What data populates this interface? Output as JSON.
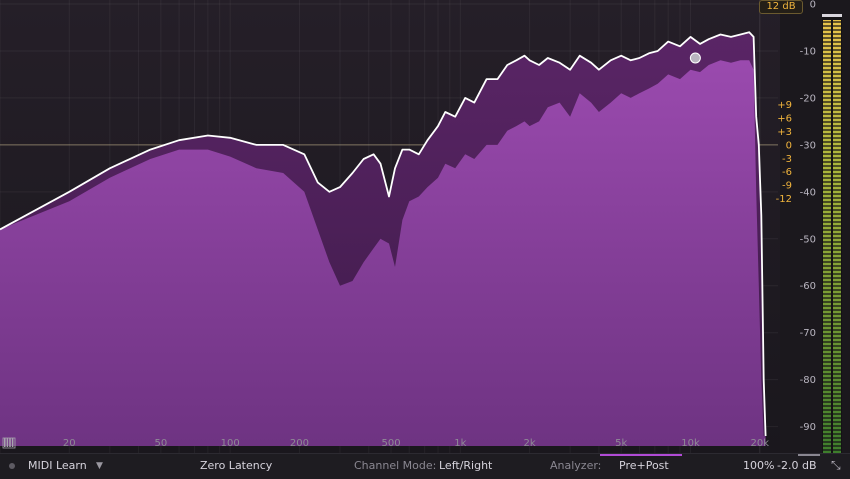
{
  "display": {
    "range_badge": "12 dB",
    "freq_labels": [
      "20",
      "50",
      "100",
      "200",
      "500",
      "1k",
      "2k",
      "5k",
      "10k",
      "20k"
    ],
    "freq_values": [
      20,
      50,
      100,
      200,
      500,
      1000,
      2000,
      5000,
      10000,
      20000
    ],
    "gain_labels": [
      "+9",
      "+6",
      "+3",
      "0",
      "-3",
      "-6",
      "-9",
      "-12"
    ],
    "gain_values": [
      9,
      6,
      3,
      0,
      -3,
      -6,
      -9,
      -12
    ],
    "analyzer_labels": [
      "0",
      "-10",
      "-20",
      "-30",
      "-40",
      "-50",
      "-60",
      "-70",
      "-80",
      "-90"
    ],
    "analyzer_values": [
      0,
      -10,
      -20,
      -30,
      -40,
      -50,
      -60,
      -70,
      -80,
      -90
    ],
    "gain_label_color": "#f0b43c",
    "analyzer_label_color": "#b9b5c0",
    "fill_color": "#8a3f9b",
    "curve_color": "#ffffff"
  },
  "footer": {
    "midi_learn": "MIDI Learn",
    "latency": "Zero Latency",
    "channel_mode_label": "Channel Mode:",
    "channel_mode_value": "Left/Right",
    "analyzer_label": "Analyzer:",
    "analyzer_value": "Pre+Post",
    "zoom": "100%",
    "output_gain": "-2.0 dB"
  },
  "chart_data": {
    "type": "area",
    "x_scale": "log",
    "xlim": [
      10,
      24000
    ],
    "eq_ylim": [
      -12,
      12
    ],
    "analyzer_ylim": [
      -92,
      0
    ],
    "x": [
      10,
      20,
      30,
      45,
      60,
      80,
      100,
      130,
      170,
      210,
      240,
      270,
      300,
      340,
      380,
      420,
      450,
      490,
      520,
      560,
      600,
      660,
      720,
      800,
      860,
      950,
      1050,
      1150,
      1300,
      1450,
      1600,
      1750,
      1900,
      2000,
      2200,
      2400,
      2700,
      3000,
      3300,
      3700,
      4000,
      4500,
      5000,
      5500,
      6000,
      6600,
      7200,
      8000,
      9000,
      10000,
      11000,
      12000,
      13500,
      15000,
      16500,
      18000,
      18800,
      19300,
      19800,
      20300,
      20800,
      21200
    ],
    "series": [
      {
        "name": "",
        "values": [
          -48,
          -40,
          -35,
          -31,
          -29,
          -28,
          -28.5,
          -30,
          -30,
          -32,
          -38,
          -40,
          -39,
          -36,
          -33,
          -32,
          -34,
          -41,
          -35,
          -31,
          -31,
          -32,
          -29,
          -26,
          -23,
          -24,
          -20,
          -21,
          -16,
          -16,
          -13,
          -12,
          -11,
          -12,
          -13,
          -11.5,
          -12.5,
          -14,
          -11,
          -12.5,
          -14,
          -12,
          -11,
          -12,
          -11.5,
          -10.5,
          -10,
          -8,
          -9,
          -7,
          -8.5,
          -7.5,
          -6.5,
          -7,
          -6.5,
          -6,
          -7,
          -24,
          -30,
          -45,
          -80,
          -92
        ]
      },
      {
        "name": "",
        "values": [
          -48,
          -42,
          -37,
          -33,
          -31,
          -31,
          -32.5,
          -35,
          -36,
          -40,
          -48,
          -55,
          -60,
          -59,
          -55,
          -52,
          -50,
          -51,
          -56,
          -46,
          -42,
          -41,
          -39,
          -37,
          -34,
          -35,
          -32,
          -33,
          -30,
          -30,
          -27,
          -26,
          -25,
          -26,
          -25,
          -22,
          -21,
          -24,
          -19,
          -21,
          -23,
          -21,
          -19,
          -20,
          -19,
          -18,
          -17,
          -15,
          -16,
          -14,
          -14.5,
          -13,
          -12,
          -12.5,
          -12,
          -12,
          -14,
          -40,
          -60,
          -80,
          -92,
          -92
        ]
      }
    ],
    "eq_node": {
      "frequency": 10500,
      "gain": 7.5
    }
  }
}
